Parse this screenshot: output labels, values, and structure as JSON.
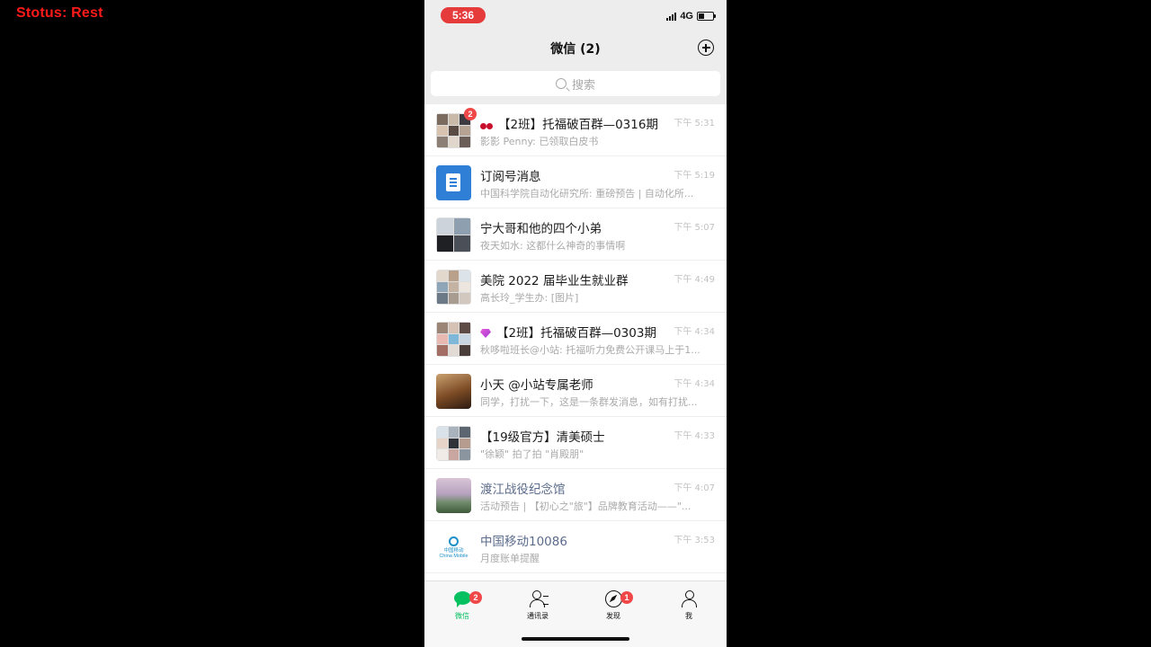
{
  "overlay": {
    "status_text": "Stotus:  Rest"
  },
  "statusbar": {
    "time": "5:36",
    "network": "4G"
  },
  "nav": {
    "title": "微信 (2)"
  },
  "search": {
    "placeholder": "搜索"
  },
  "colors": {
    "accent_green": "#07c160",
    "badge_red": "#f04848",
    "time_pill": "#e53b3b"
  },
  "chats": [
    {
      "title": "【2班】托福破百群—0316期",
      "emoji": "cherry-icon",
      "preview": "影影 Penny: 已领取白皮书",
      "time": "下午 5:31",
      "badge": "2",
      "avatar": "group-avatar"
    },
    {
      "title": "订阅号消息",
      "preview": "中国科学院自动化研究所: 重磅预告 | 自动化所...",
      "time": "下午 5:19",
      "avatar": "subscription-avatar"
    },
    {
      "title": "宁大哥和他的四个小弟",
      "preview": "夜天如水: 这都什么神奇的事情啊",
      "time": "下午 5:07",
      "avatar": "group-avatar"
    },
    {
      "title": "美院 2022 届毕业生就业群",
      "preview": "高长玲_学生办: [图片]",
      "time": "下午 4:49",
      "avatar": "group-avatar"
    },
    {
      "title": "【2班】托福破百群—0303期",
      "emoji": "gem-icon",
      "preview": "秋哆啦班长@小站: 托福听力免费公开课马上于1...",
      "time": "下午 4:34",
      "avatar": "group-avatar"
    },
    {
      "title": "小天 @小站专属老师",
      "preview": "同学，打扰一下，这是一条群发消息，如有打扰...",
      "time": "下午 4:34",
      "avatar": "photo-avatar"
    },
    {
      "title": "【19级官方】清美硕士",
      "preview": "\"徐颖\" 拍了拍 \"肖殿朋\"",
      "time": "下午 4:33",
      "avatar": "group-avatar"
    },
    {
      "title": "渡江战役纪念馆",
      "preview": "活动预告 | 【初心之\"旅\"】品牌教育活动——\"...",
      "time": "下午 4:07",
      "avatar": "landscape-avatar",
      "link_style": true
    },
    {
      "title": "中国移动10086",
      "preview": "月度账单提醒",
      "time": "下午 3:53",
      "avatar": "china-mobile-logo",
      "link_style": true
    }
  ],
  "china_mobile_logo": {
    "line1": "中国移动",
    "line2": "China Mobile"
  },
  "tabs": [
    {
      "label": "微信",
      "icon": "chat-bubble-icon",
      "badge": "2",
      "active": true
    },
    {
      "label": "通讯录",
      "icon": "contacts-icon"
    },
    {
      "label": "发现",
      "icon": "compass-icon",
      "badge": "1"
    },
    {
      "label": "我",
      "icon": "profile-icon"
    }
  ]
}
